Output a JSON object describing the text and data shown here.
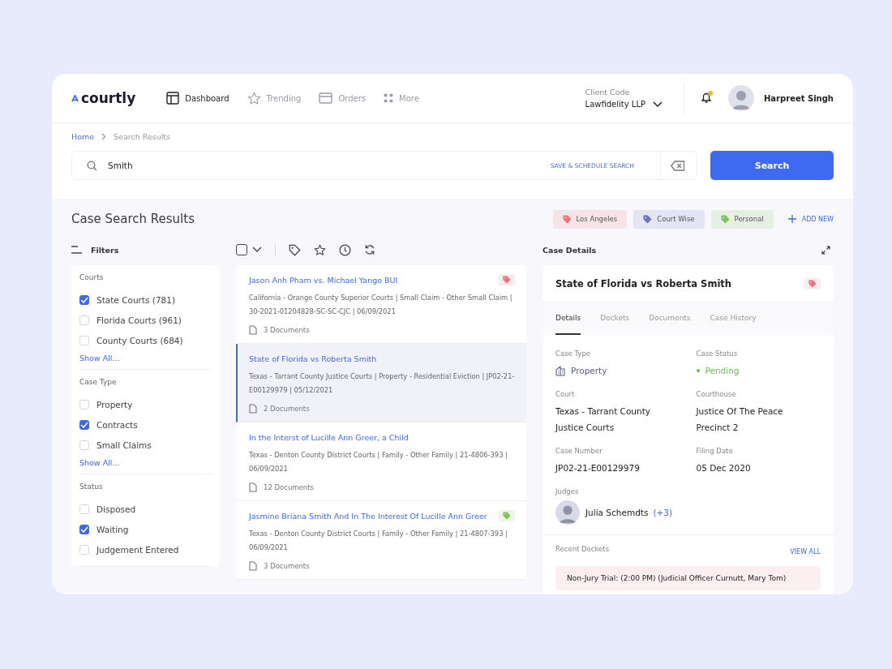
{
  "logo": {
    "text": "courtly"
  },
  "nav": [
    {
      "label": "Dashboard",
      "selected": true
    },
    {
      "label": "Trending",
      "selected": false
    },
    {
      "label": "Orders",
      "selected": false
    },
    {
      "label": "More",
      "selected": false
    }
  ],
  "client": {
    "label": "Client Code",
    "value": "Lawfidelity LLP"
  },
  "notifications": {
    "unread": true
  },
  "user": {
    "name": "Harpreet Singh"
  },
  "breadcrumb": [
    {
      "label": "Home",
      "selected": false
    },
    {
      "label": "Search Results",
      "selected": true
    }
  ],
  "search": {
    "value": "Smith",
    "save_label": "SAVE & SCHEDULE SEARCH",
    "button": "Search"
  },
  "results_title": "Case Search Results",
  "tags": [
    {
      "label": "Los Angeles",
      "color": "#f0707e"
    },
    {
      "label": "Court Wise",
      "color": "#6b72c8"
    },
    {
      "label": "Personal",
      "color": "#7cc35a"
    }
  ],
  "add_new": "ADD NEW",
  "filters": {
    "title": "Filters",
    "groups": [
      {
        "title": "Courts",
        "show_all": "Show All...",
        "options": [
          {
            "label": "State Courts (781)",
            "checked": true
          },
          {
            "label": "Florida Courts (961)",
            "checked": false
          },
          {
            "label": "County Courts (684)",
            "checked": false
          }
        ]
      },
      {
        "title": "Case Type",
        "show_all": "Show All...",
        "options": [
          {
            "label": "Property",
            "checked": false
          },
          {
            "label": "Contracts",
            "checked": true
          },
          {
            "label": "Small Claims",
            "checked": false
          }
        ]
      },
      {
        "title": "Status",
        "options": [
          {
            "label": "Disposed",
            "checked": false
          },
          {
            "label": "Waiting",
            "checked": true
          },
          {
            "label": "Judgement Entered",
            "checked": false
          }
        ]
      }
    ]
  },
  "toolbar": {
    "select_all": {
      "checked": false
    }
  },
  "results": [
    {
      "title": "Jason Anh Pham vs. Michael Yango BUI",
      "meta": "California - Orange County Superior Courts | Small Claim - Other Small Claim | 30-2021-01204828-SC-SC-CJC | 06/09/2021",
      "documents": "3 Documents",
      "selected": false,
      "color": "#f0707e"
    },
    {
      "title": "State of Florida vs Roberta Smith",
      "meta": "Texas - Tarrant County Justice Courts | Property - Residential Eviction | JP02-21-E00129979 | 05/12/2021",
      "documents": "2 Documents",
      "selected": true
    },
    {
      "title": "In the Interst of Lucille Ann Greer, a Child",
      "meta": "Texas - Denton County District Courts | Family - Other Family | 21-4806-393 | 06/09/2021",
      "documents": "12 Documents",
      "selected": false
    },
    {
      "title": "Jasmine Briana Smith And In The Interest Of Lucille Ann Greer",
      "meta": "Texas - Denton County District Courts | Family - Other Family | 21-4807-393 | 06/09/2021",
      "documents": "3 Documents",
      "selected": false,
      "color": "#7cc35a"
    }
  ],
  "details": {
    "heading": "Case Details",
    "title": "State of Florida vs Roberta Smith",
    "color": "#f0707e",
    "tabs": [
      {
        "label": "Details",
        "selected": true
      },
      {
        "label": "Dockets",
        "selected": false
      },
      {
        "label": "Documents",
        "selected": false
      },
      {
        "label": "Case History",
        "selected": false
      }
    ],
    "fields": [
      {
        "label": "Case Type",
        "value": "Property",
        "kind": "type"
      },
      {
        "label": "Case Status",
        "value": "Pending",
        "kind": "status"
      },
      {
        "label": "Court",
        "value": "Texas - Tarrant County Justice Courts",
        "kind": "plain"
      },
      {
        "label": "Courthouse",
        "value": "Justice Of The Peace Precinct 2",
        "kind": "plain"
      },
      {
        "label": "Case Number",
        "value": "JP02-21-E00129979",
        "kind": "plain"
      },
      {
        "label": "Filing Date",
        "value": "05 Dec 2020",
        "kind": "plain"
      }
    ],
    "judges": {
      "label": "Judges",
      "name": "Julia Schemdts",
      "more": "(+3)"
    },
    "recent": {
      "label": "Recent Dockets",
      "view_all": "VIEW ALL",
      "items": [
        "Non-Jury Trial: (2:00 PM) (Judicial Officer Curnutt, Mary Tom)"
      ]
    }
  }
}
